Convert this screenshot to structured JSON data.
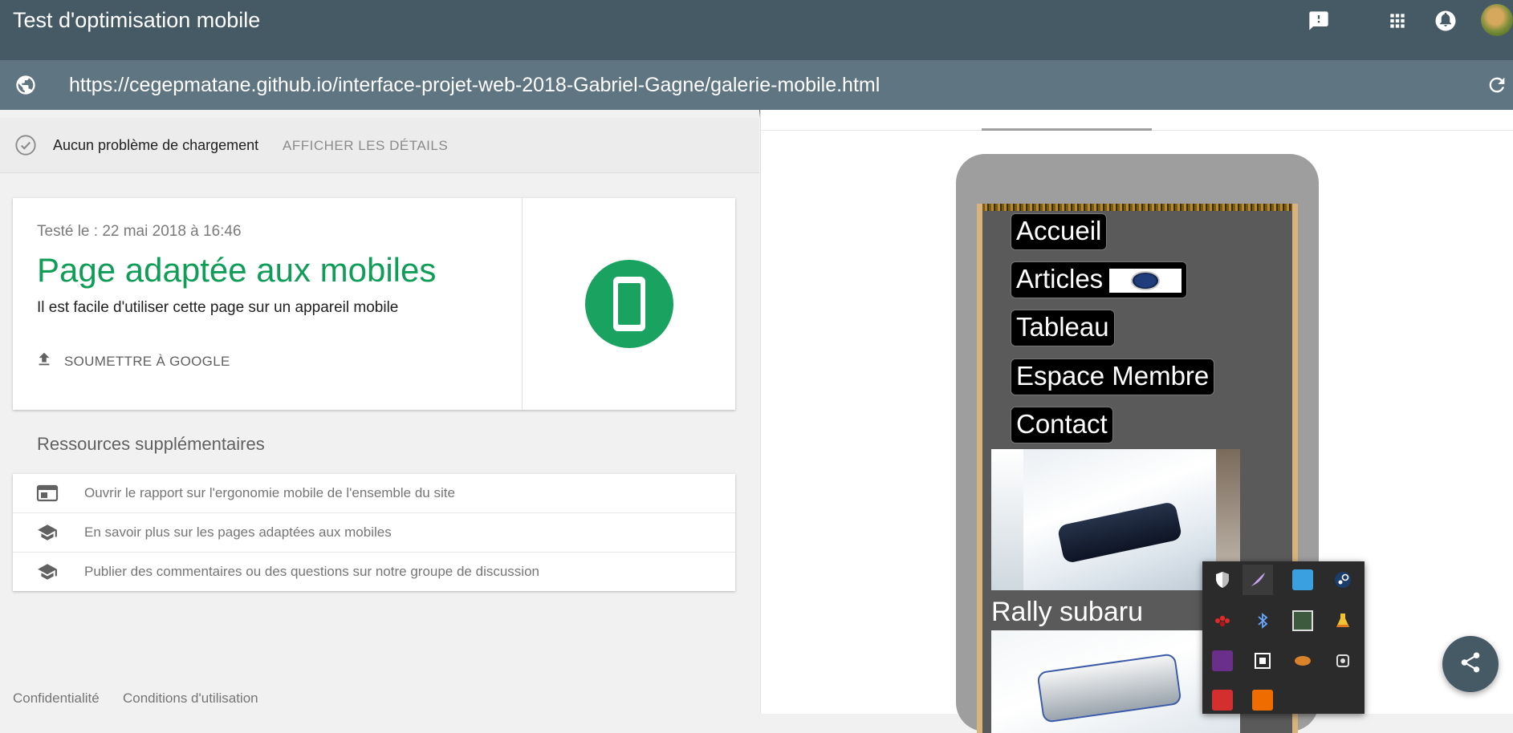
{
  "app": {
    "title": "Test d'optimisation mobile"
  },
  "header_icons": [
    "feedback-icon",
    "apps-grid-icon",
    "notifications-icon",
    "account-avatar"
  ],
  "url_bar": {
    "url": "https://cegepmatane.github.io/interface-projet-web-2018-Gabriel-Gagne/galerie-mobile.html"
  },
  "status": {
    "text": "Aucun problème de chargement",
    "details_label": "AFFICHER LES DÉTAILS"
  },
  "result": {
    "tested_on": "Testé le : 22 mai 2018 à 16:46",
    "verdict": "Page adaptée aux mobiles",
    "subtitle": "Il est facile d'utiliser cette page sur un appareil mobile",
    "submit_label": "SOUMETTRE À GOOGLE"
  },
  "resources": {
    "title": "Ressources supplémentaires",
    "items": [
      {
        "icon": "web-report-icon",
        "label": "Ouvrir le rapport sur l'ergonomie mobile de l'ensemble du site"
      },
      {
        "icon": "school-icon",
        "label": "En savoir plus sur les pages adaptées aux mobiles"
      },
      {
        "icon": "school-icon",
        "label": "Publier des commentaires ou des questions sur notre groupe de discussion"
      }
    ]
  },
  "footer": {
    "privacy": "Confidentialité",
    "terms": "Conditions d'utilisation"
  },
  "preview": {
    "nav": [
      "Accueil",
      "Articles",
      "Tableau",
      "Espace Membre",
      "Contact"
    ],
    "caption": "Rally subaru"
  },
  "colors": {
    "appbar": "#455a64",
    "urlbar": "#5f7581",
    "success": "#0f9d58"
  }
}
